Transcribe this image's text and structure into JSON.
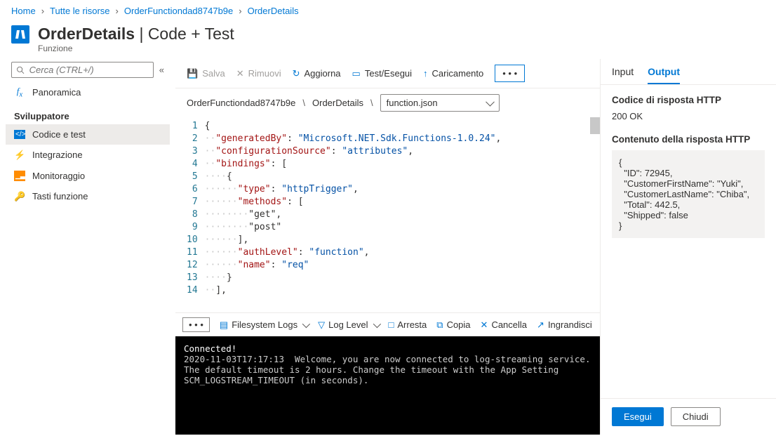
{
  "breadcrumb": [
    "Home",
    "Tutte le risorse",
    "OrderFunctiondad8747b9e",
    "OrderDetails"
  ],
  "header": {
    "title": "OrderDetails",
    "suffix": " | Code + Test",
    "subtitle": "Funzione"
  },
  "search": {
    "placeholder": "Cerca (CTRL+/)"
  },
  "nav": {
    "overview": "Panoramica",
    "section": "Sviluppatore",
    "items": [
      "Codice e test",
      "Integrazione",
      "Monitoraggio",
      "Tasti funzione"
    ]
  },
  "toolbar": {
    "save": "Salva",
    "remove": "Rimuovi",
    "refresh": "Aggiorna",
    "test": "Test/Esegui",
    "upload": "Caricamento"
  },
  "path": {
    "p1": "OrderFunctiondad8747b9e",
    "p2": "OrderDetails",
    "file": "function.json"
  },
  "code_lines": [
    "{",
    "  \"generatedBy\": \"Microsoft.NET.Sdk.Functions-1.0.24\",",
    "  \"configurationSource\": \"attributes\",",
    "  \"bindings\": [",
    "    {",
    "      \"type\": \"httpTrigger\",",
    "      \"methods\": [",
    "        \"get\",",
    "        \"post\"",
    "      ],",
    "      \"authLevel\": \"function\",",
    "      \"name\": \"req\"",
    "    }",
    "  ],"
  ],
  "logbar": {
    "fslogs": "Filesystem Logs",
    "loglevel": "Log Level",
    "stop": "Arresta",
    "copy": "Copia",
    "clear": "Cancella",
    "expand": "Ingrandisci"
  },
  "console": {
    "connected": "Connected!",
    "msg": "2020-11-03T17:17:13  Welcome, you are now connected to log-streaming service. The default timeout is 2 hours. Change the timeout with the App Setting SCM_LOGSTREAM_TIMEOUT (in seconds)."
  },
  "panel": {
    "tab_input": "Input",
    "tab_output": "Output",
    "code_label": "Codice di risposta HTTP",
    "code_value": "200 OK",
    "content_label": "Contenuto della risposta HTTP",
    "content_value": "{\n  \"ID\": 72945,\n  \"CustomerFirstName\": \"Yuki\",\n  \"CustomerLastName\": \"Chiba\",\n  \"Total\": 442.5,\n  \"Shipped\": false\n}",
    "run": "Esegui",
    "close": "Chiudi"
  }
}
